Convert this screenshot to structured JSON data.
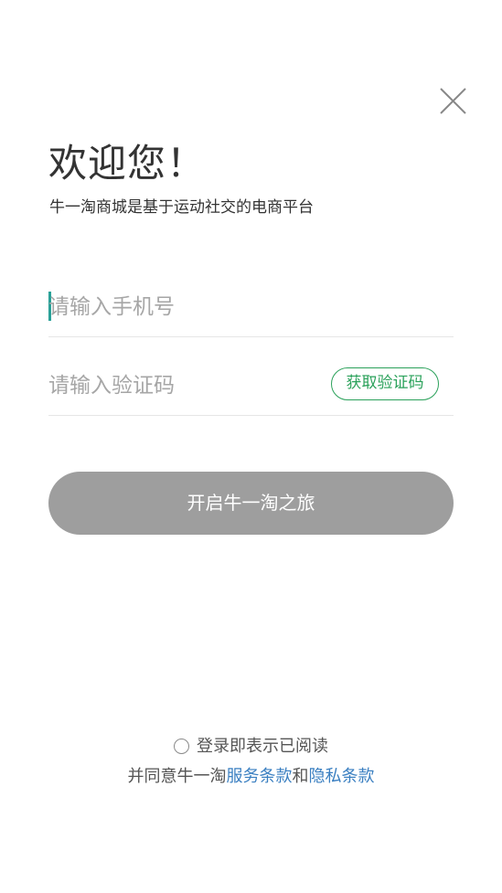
{
  "colors": {
    "accent_green": "#2aa15a",
    "link_blue": "#3a7fc1",
    "button_disabled_gray": "#9e9e9e",
    "caret_teal": "#2aa198"
  },
  "icons": {
    "close": "close-icon"
  },
  "header": {
    "title": "欢迎您！",
    "subtitle": "牛一淘商城是基于运动社交的电商平台"
  },
  "form": {
    "phone": {
      "value": "",
      "placeholder": "请输入手机号"
    },
    "code": {
      "value": "",
      "placeholder": "请输入验证码",
      "get_code_label": "获取验证码"
    },
    "submit_label": "开启牛一淘之旅"
  },
  "agreement": {
    "checked": false,
    "line1": "登录即表示已阅读",
    "line2_prefix": "并同意牛一淘",
    "service_terms": "服务条款",
    "conjunction": "和",
    "privacy_terms": "隐私条款"
  }
}
